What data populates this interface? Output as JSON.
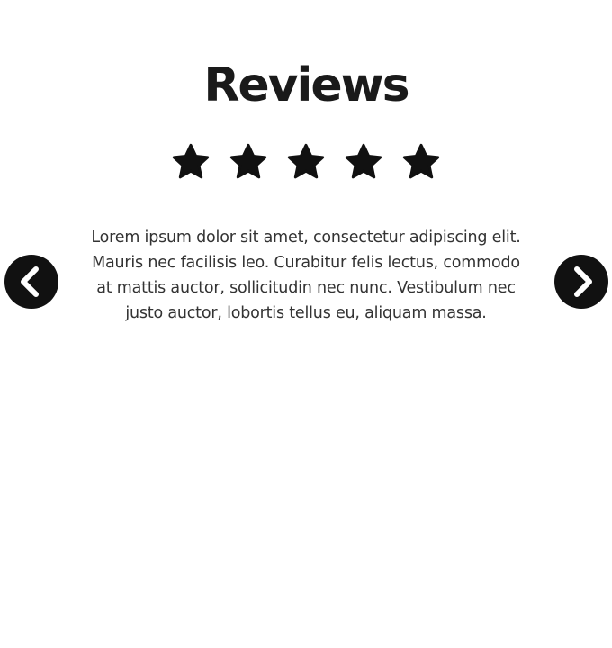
{
  "reviews": {
    "title": "Reviews",
    "rating": 5,
    "max_rating": 5,
    "star_icon": "star-icon",
    "review_text": "Lorem ipsum dolor sit amet, consectetur adipiscing elit. Mauris nec facilisis leo. Curabitur felis lectus, commodo at mattis auctor, sollicitudin nec nunc. Vestibulum nec justo auctor, lobortis tellus eu, aliquam massa.",
    "prev_icon": "chevron-left-circle-icon",
    "next_icon": "chevron-right-circle-icon",
    "colors": {
      "text": "#333333",
      "title": "#1a1a1a",
      "icon": "#111111",
      "background": "#ffffff"
    }
  }
}
